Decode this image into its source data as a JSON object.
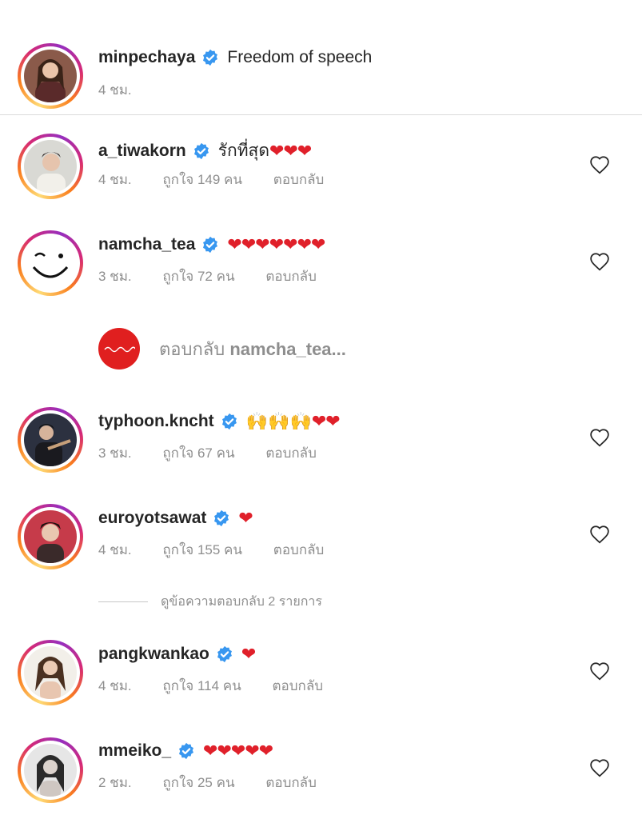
{
  "post_caption": {
    "username": "minpechaya",
    "text": "Freedom of speech",
    "time": "4 ชม."
  },
  "comments": [
    {
      "username": "a_tiwakorn",
      "text": "รักที่สุด",
      "hearts": "❤❤❤",
      "time": "4 ชม.",
      "likes": "ถูกใจ 149 คน",
      "reply": "ตอบกลับ"
    },
    {
      "username": "namcha_tea",
      "text": "",
      "hearts": "❤❤❤❤❤❤❤",
      "time": "3 ชม.",
      "likes": "ถูกใจ 72 คน",
      "reply": "ตอบกลับ"
    },
    {
      "username": "typhoon.kncht",
      "text": "🙌🙌🙌",
      "hearts": "❤❤",
      "time": "3 ชม.",
      "likes": "ถูกใจ 67 คน",
      "reply": "ตอบกลับ"
    },
    {
      "username": "euroyotsawat",
      "text": "",
      "hearts": "❤",
      "time": "4 ชม.",
      "likes": "ถูกใจ 155 คน",
      "reply": "ตอบกลับ"
    },
    {
      "username": "pangkwankao",
      "text": "",
      "hearts": "❤",
      "time": "4 ชม.",
      "likes": "ถูกใจ 114 คน",
      "reply": "ตอบกลับ"
    },
    {
      "username": "mmeiko_",
      "text": "",
      "hearts": "❤❤❤❤❤",
      "time": "2 ชม.",
      "likes": "ถูกใจ 25 คน",
      "reply": "ตอบกลับ"
    }
  ],
  "reply_bar": {
    "prefix": "ตอบกลับ",
    "target": "namcha_tea..."
  },
  "view_replies": "ดูข้อความตอบกลับ 2 รายการ",
  "colors": {
    "verified": "#3897f0",
    "heart_red": "#e0202a",
    "meta_gray": "#8e8e8e"
  }
}
